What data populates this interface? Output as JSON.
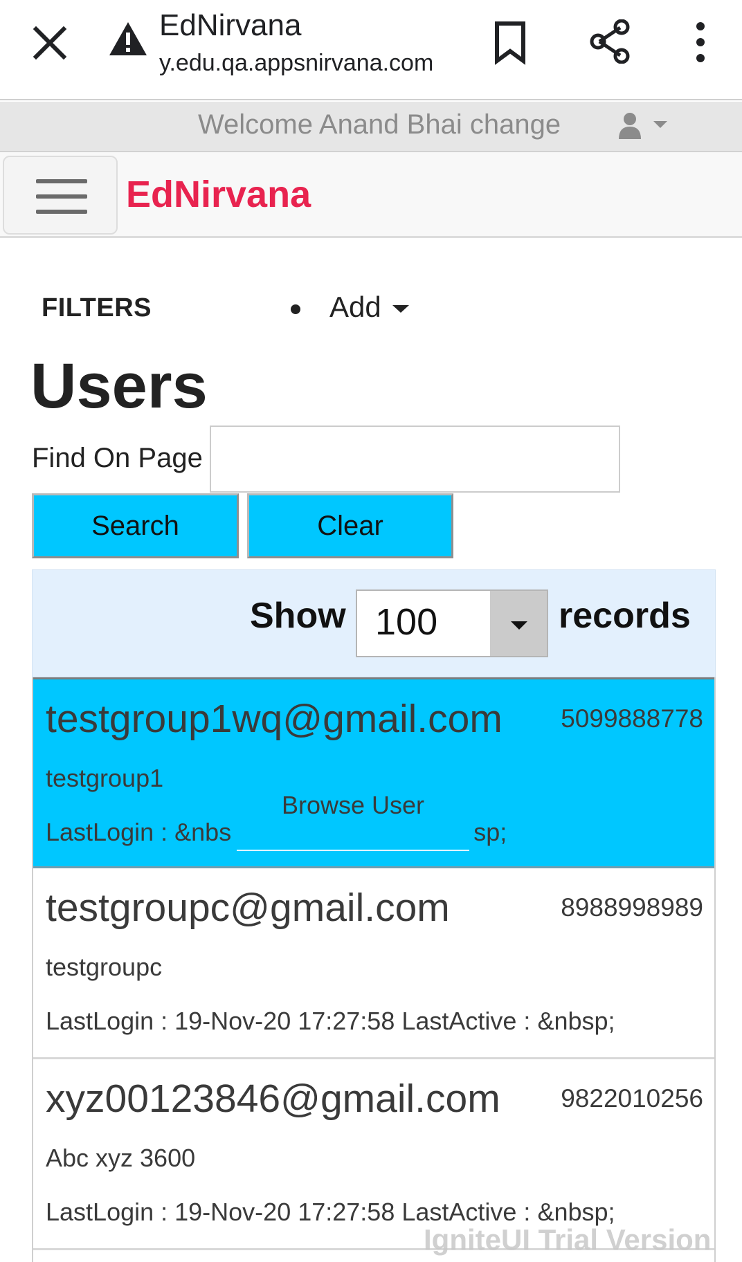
{
  "browser": {
    "title": "EdNirvana",
    "url": "y.edu.qa.appsnirvana.com"
  },
  "welcome": {
    "text": "Welcome Anand Bhai change"
  },
  "navbar": {
    "brand": "EdNirvana"
  },
  "toolbar": {
    "filters_label": "FILTERS",
    "add_label": "Add"
  },
  "page": {
    "title": "Users"
  },
  "find": {
    "label": "Find On Page",
    "value": "",
    "search_label": "Search",
    "clear_label": "Clear"
  },
  "show": {
    "show_label": "Show",
    "selected": "100",
    "records_label": "records"
  },
  "users": [
    {
      "email": "testgroup1wq@gmail.com",
      "phone": "5099888778",
      "name": "testgroup1",
      "login_left": "LastLogin : &nbs",
      "login_right": "sp;",
      "selected": true,
      "overlay": "Browse User"
    },
    {
      "email": "testgroupc@gmail.com",
      "phone": "8988998989",
      "name": "testgroupc",
      "login": "LastLogin : 19-Nov-20 17:27:58 LastActive : &nbsp;"
    },
    {
      "email": "xyz00123846@gmail.com",
      "phone": "9822010256",
      "name": "Abc xyz 3600",
      "login": "LastLogin : 19-Nov-20 17:27:58 LastActive : &nbsp;"
    }
  ],
  "watermark": "IgniteUI Trial Version",
  "colors": {
    "brand": "#e8234f",
    "accent": "#00c7ff",
    "show_bar": "#e3f0fd",
    "welcome_bar": "#e6e6e6"
  },
  "icons": [
    "close-icon",
    "warning-icon",
    "bookmark-icon",
    "share-icon",
    "more-vert-icon",
    "user-icon",
    "chevron-down-icon",
    "hamburger-icon"
  ]
}
